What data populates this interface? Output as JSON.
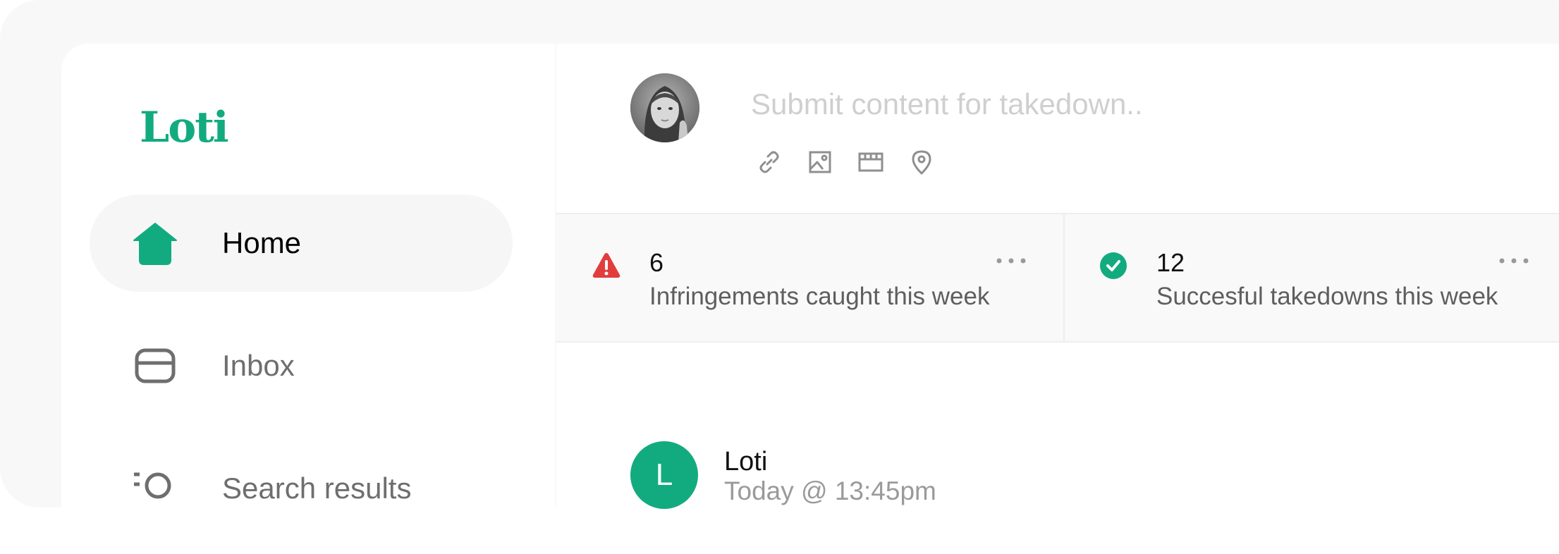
{
  "brand": {
    "name": "Loti",
    "accent_color": "#12ab7f"
  },
  "sidebar": {
    "items": [
      {
        "label": "Home",
        "icon": "home-icon",
        "active": true
      },
      {
        "label": "Inbox",
        "icon": "inbox-icon",
        "active": false
      },
      {
        "label": "Search results",
        "icon": "search-results-icon",
        "active": false
      }
    ]
  },
  "composer": {
    "placeholder": "Submit content for takedown..",
    "tools": [
      "link-icon",
      "image-icon",
      "video-icon",
      "location-icon"
    ]
  },
  "stats": [
    {
      "value": "6",
      "label": "Infringements caught this week",
      "icon": "warning-icon",
      "icon_color": "#e23d3d"
    },
    {
      "value": "12",
      "label": "Succesful takedowns this week",
      "icon": "check-circle-icon",
      "icon_color": "#12ab7f"
    }
  ],
  "post": {
    "avatar_letter": "L",
    "author": "Loti",
    "time": "Today @ 13:45pm"
  }
}
